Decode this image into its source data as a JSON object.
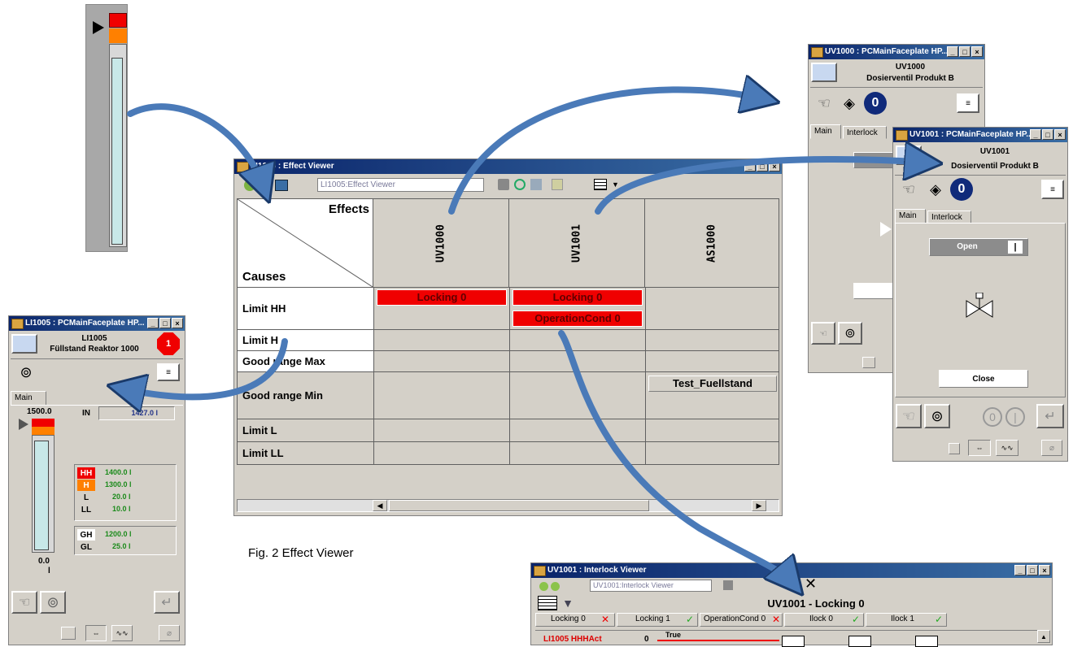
{
  "caption": "Fig. 2 Effect Viewer",
  "colors": {
    "titlebar": "#0a246a",
    "alarm_red": "#f00000",
    "alarm_orange": "#ff8000",
    "bar_fill": "#c8e8e8",
    "arrow": "#4a7ab8"
  },
  "effect_viewer": {
    "title": "LI1005 : Effect Viewer",
    "address": "LI1005:Effect Viewer",
    "effects_header": "Effects",
    "causes_header": "Causes",
    "columns": [
      "UV1000",
      "UV1001",
      "AS1000"
    ],
    "rows": [
      "Limit HH",
      "Limit H",
      "Good range Max",
      "Good range Min",
      "Limit L",
      "Limit LL"
    ],
    "cells": {
      "hh_uv1000": "Locking 0",
      "hh_uv1001_a": "Locking 0",
      "hh_uv1001_b": "OperationCond 0",
      "grmin_as1000": "Test_Fuellstand"
    }
  },
  "faceplate_li1005": {
    "title": "LI1005 : PCMainFaceplate HP...",
    "tag": "LI1005",
    "description": "Füllstand Reaktor 1000",
    "alarm_badge": "1",
    "tab_main": "Main",
    "scale_top": "1500.0",
    "scale_bottom": "0.0",
    "unit": "l",
    "in_label": "IN",
    "in_value": "1427.0 l",
    "limits": [
      {
        "label": "HH",
        "value": "1400.0 l"
      },
      {
        "label": "H",
        "value": "1300.0 l"
      },
      {
        "label": "L",
        "value": "20.0 l"
      },
      {
        "label": "LL",
        "value": "10.0 l"
      }
    ],
    "good": [
      {
        "label": "GH",
        "value": "1200.0 l"
      },
      {
        "label": "GL",
        "value": "25.0 l"
      }
    ],
    "level_fraction": 0.95
  },
  "faceplate_uv1000": {
    "title": "UV1000 : PCMainFaceplate HP...",
    "tag": "UV1000",
    "description": "Dosierventil Produkt B",
    "tab_main": "Main",
    "tab_interlock": "Interlock"
  },
  "faceplate_uv1001": {
    "title": "UV1001 : PCMainFaceplate HP...",
    "tag": "UV1001",
    "description": "Dosierventil Produkt B",
    "tab_main": "Main",
    "tab_interlock": "Interlock",
    "open_label": "Open",
    "close_label": "Close"
  },
  "interlock_viewer": {
    "title": "UV1001 : Interlock Viewer",
    "address": "UV1001:Interlock Viewer",
    "heading": "UV1001 - Locking 0",
    "tabs": [
      {
        "label": "Locking 0",
        "state": "bad"
      },
      {
        "label": "Locking 1",
        "state": "ok"
      },
      {
        "label": "OperationCond 0",
        "state": "bad"
      },
      {
        "label": "Ilock 0",
        "state": "ok"
      },
      {
        "label": "Ilock 1",
        "state": "ok"
      }
    ],
    "row_label": "LI1005 HHHAct",
    "row_value": "0",
    "row_true": "True"
  }
}
